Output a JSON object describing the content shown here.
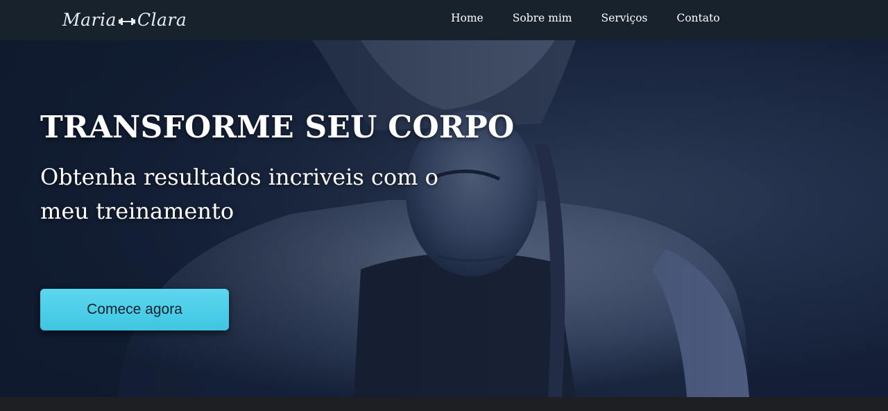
{
  "brand": {
    "logo_left": "Maria",
    "logo_right": "Clara"
  },
  "nav": {
    "items": [
      {
        "label": "Home"
      },
      {
        "label": "Sobre mim"
      },
      {
        "label": "Serviços"
      },
      {
        "label": "Contato"
      }
    ]
  },
  "hero": {
    "title": "TRANSFORME SEU CORPO",
    "subtitle": "Obtenha resultados incriveis com o meu treinamento",
    "cta_label": "Comece agora"
  },
  "colors": {
    "navbar_bg": "#18222c",
    "hero_overlay": "#152038",
    "accent": "#4cd0e8",
    "footer_bg": "#1e1f22"
  }
}
